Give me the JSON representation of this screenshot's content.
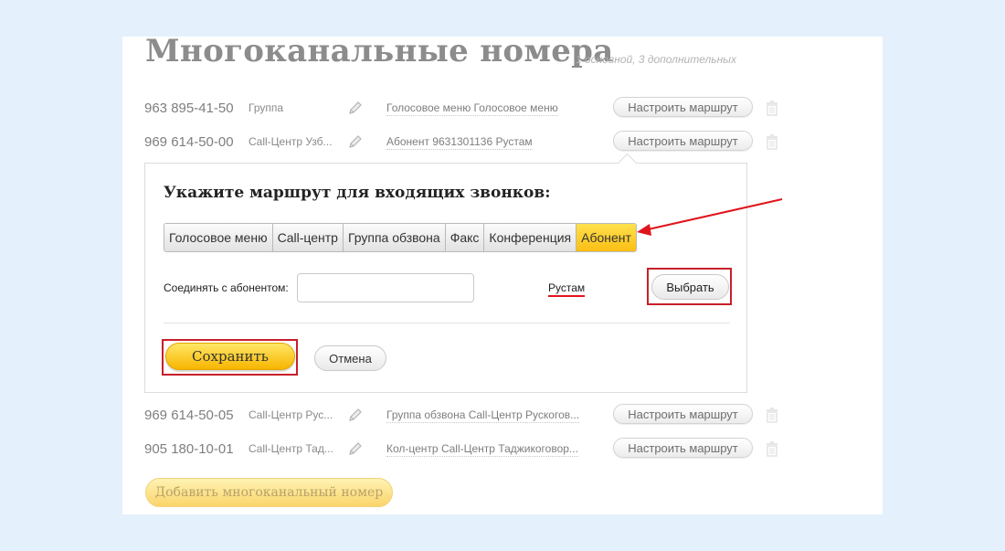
{
  "page": {
    "title": "Многоканальные номера",
    "subtitle": "1 основной, 3 дополнительных"
  },
  "numbers": [
    {
      "phone": "963 895-41-50",
      "group": "Группа",
      "route": "Голосовое меню Голосовое меню",
      "button": "Настроить маршрут"
    },
    {
      "phone": "969 614-50-00",
      "group": "Call-Центр Узб...",
      "route": "Абонент 9631301136 Рустам",
      "button": "Настроить маршрут"
    },
    {
      "phone": "969 614-50-05",
      "group": "Call-Центр Рус...",
      "route": "Группа обзвона Call-Центр Рускогов...",
      "button": "Настроить маршрут"
    },
    {
      "phone": "905 180-10-01",
      "group": "Call-Центр Тад...",
      "route": "Кол-центр Call-Центр Таджикоговор...",
      "button": "Настроить маршрут"
    }
  ],
  "route_panel": {
    "title": "Укажите маршрут для входящих звонков:",
    "tabs": [
      {
        "label": "Голосовое меню",
        "active": false
      },
      {
        "label": "Call-центр",
        "active": false
      },
      {
        "label": "Группа обзвона",
        "active": false
      },
      {
        "label": "Факс",
        "active": false
      },
      {
        "label": "Конференция",
        "active": false
      },
      {
        "label": "Абонент",
        "active": true
      }
    ],
    "connect_label": "Соединять с абонентом:",
    "subscriber_input_value": "",
    "subscriber_link": "Рустам",
    "choose_button": "Выбрать",
    "save_button": "Сохранить",
    "cancel_button": "Отмена"
  },
  "add_button": "Добавить многоканальный номер",
  "colors": {
    "accent_yellow": "#fbbe13",
    "highlight_red": "#c8202a",
    "text_gray": "#8c8c8c"
  },
  "icons": [
    "pencil-icon",
    "trash-icon"
  ]
}
